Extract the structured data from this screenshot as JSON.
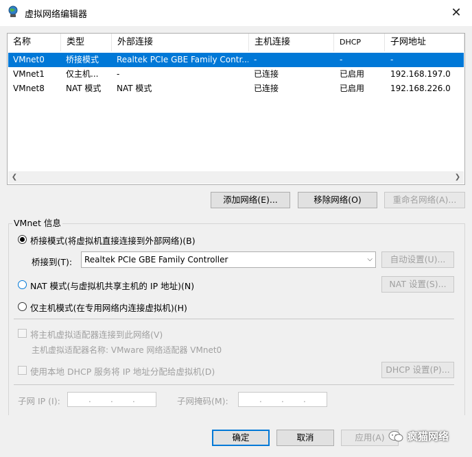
{
  "window": {
    "title": "虚拟网络编辑器"
  },
  "table": {
    "headers": [
      "名称",
      "类型",
      "外部连接",
      "主机连接",
      "DHCP",
      "子网地址"
    ],
    "rows": [
      [
        "VMnet0",
        "桥接模式",
        "Realtek PCIe GBE Family Contr...",
        "-",
        "-",
        "-"
      ],
      [
        "VMnet1",
        "仅主机...",
        "-",
        "已连接",
        "已启用",
        "192.168.197.0"
      ],
      [
        "VMnet8",
        "NAT 模式",
        "NAT 模式",
        "已连接",
        "已启用",
        "192.168.226.0"
      ]
    ]
  },
  "buttons": {
    "add_network": "添加网络(E)...",
    "remove_network": "移除网络(O)",
    "rename_network": "重命名网络(A)...",
    "auto_settings": "自动设置(U)...",
    "nat_settings": "NAT 设置(S)...",
    "dhcp_settings": "DHCP 设置(P)...",
    "ok": "确定",
    "cancel": "取消",
    "apply": "应用(A)"
  },
  "info": {
    "group_label": "VMnet 信息",
    "bridged": "桥接模式(将虚拟机直接连接到外部网络)(B)",
    "bridge_to_label": "桥接到(T):",
    "bridge_to_value": "Realtek PCIe GBE Family Controller",
    "nat": "NAT 模式(与虚拟机共享主机的 IP 地址)(N)",
    "host_only": "仅主机模式(在专用网络内连接虚拟机)(H)",
    "connect_adapter": "将主机虚拟适配器连接到此网络(V)",
    "adapter_name": "主机虚拟适配器名称: VMware 网络适配器 VMnet0",
    "use_dhcp": "使用本地 DHCP 服务将 IP 地址分配给虚拟机(D)",
    "subnet_ip_label": "子网 IP (I):",
    "subnet_mask_label": "子网掩码(M):",
    "ip_dot": "."
  },
  "watermark": {
    "text": "疯猫网络"
  }
}
